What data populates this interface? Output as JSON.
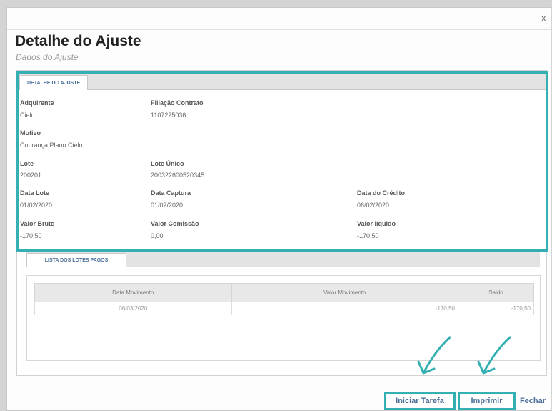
{
  "dialog": {
    "close_label": "x",
    "title": "Detalhe do Ajuste",
    "subtitle": "Dados do Ajuste"
  },
  "tab_detail": {
    "label": "DETALHE DO AJUSTE"
  },
  "fields": {
    "adquirente": {
      "label": "Adquirente",
      "value": "Cielo"
    },
    "filiacao": {
      "label": "Filiação Contrato",
      "value": "1107225036"
    },
    "motivo": {
      "label": "Motivo",
      "value": "Cobrança Plano Cielo"
    },
    "lote": {
      "label": "Lote",
      "value": "200201"
    },
    "lote_unico": {
      "label": "Lote Único",
      "value": "200322600520345"
    },
    "data_lote": {
      "label": "Data Lote",
      "value": "01/02/2020"
    },
    "data_captura": {
      "label": "Data Captura",
      "value": "01/02/2020"
    },
    "data_credito": {
      "label": "Data do Crédito",
      "value": "06/02/2020"
    },
    "valor_bruto": {
      "label": "Valor Bruto",
      "value": "-170,50"
    },
    "valor_comissao": {
      "label": "Valor Comissão",
      "value": "0,00"
    },
    "valor_liquido": {
      "label": "Valor líquido",
      "value": "-170,50"
    }
  },
  "tab_lotes": {
    "label": "LISTA DOS LOTES PAGOS"
  },
  "table": {
    "headers": {
      "date": "Data Movimento",
      "value": "Valor Movimento",
      "saldo": "Saldo"
    },
    "rows": [
      {
        "date": "06/03/2020",
        "value": "-170,50",
        "saldo": "-170,50"
      }
    ]
  },
  "buttons": {
    "iniciar": "Iniciar Tarefa",
    "imprimir": "Imprimir",
    "fechar": "Fechar"
  },
  "colors": {
    "highlight": "#34b0b2",
    "link": "#4a6f99"
  }
}
